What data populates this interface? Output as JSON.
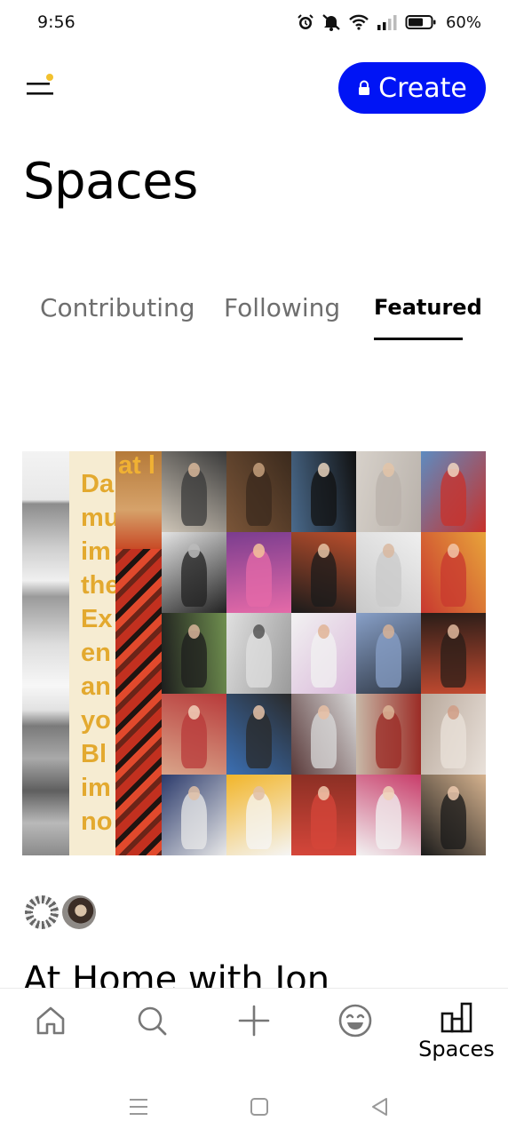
{
  "status_bar": {
    "time": "9:56",
    "battery": "60%",
    "icons": [
      "alarm-icon",
      "mute-icon",
      "wifi-icon",
      "signal-icon",
      "battery-icon"
    ]
  },
  "header": {
    "menu_icon": "menu-icon",
    "notification_dot_color": "#f2c12e",
    "create_label": "Create",
    "create_icon": "lock-icon",
    "accent": "#0014f5"
  },
  "page": {
    "title": "Spaces"
  },
  "tabs": [
    {
      "label": "Contributing",
      "active": false
    },
    {
      "label": "Following",
      "active": false
    },
    {
      "label": "Featured",
      "active": true
    }
  ],
  "featured_space": {
    "cover_text_fragments": [
      "Da",
      "mu",
      "im",
      "the",
      "Ex",
      "en",
      "an",
      "yo",
      "Bl",
      "im",
      "no"
    ],
    "cover_rug_text": "at l",
    "contributors": [
      "contributor-avatar-ring",
      "contributor-avatar-photo"
    ],
    "title": "At Home with Jon"
  },
  "bottom_nav": {
    "items": [
      {
        "icon": "home-icon",
        "label": ""
      },
      {
        "icon": "search-icon",
        "label": ""
      },
      {
        "icon": "plus-icon",
        "label": ""
      },
      {
        "icon": "smiley-icon",
        "label": ""
      },
      {
        "icon": "spaces-icon",
        "label": "Spaces"
      }
    ]
  },
  "system_nav": [
    "recents-icon",
    "home-square-icon",
    "back-icon"
  ]
}
